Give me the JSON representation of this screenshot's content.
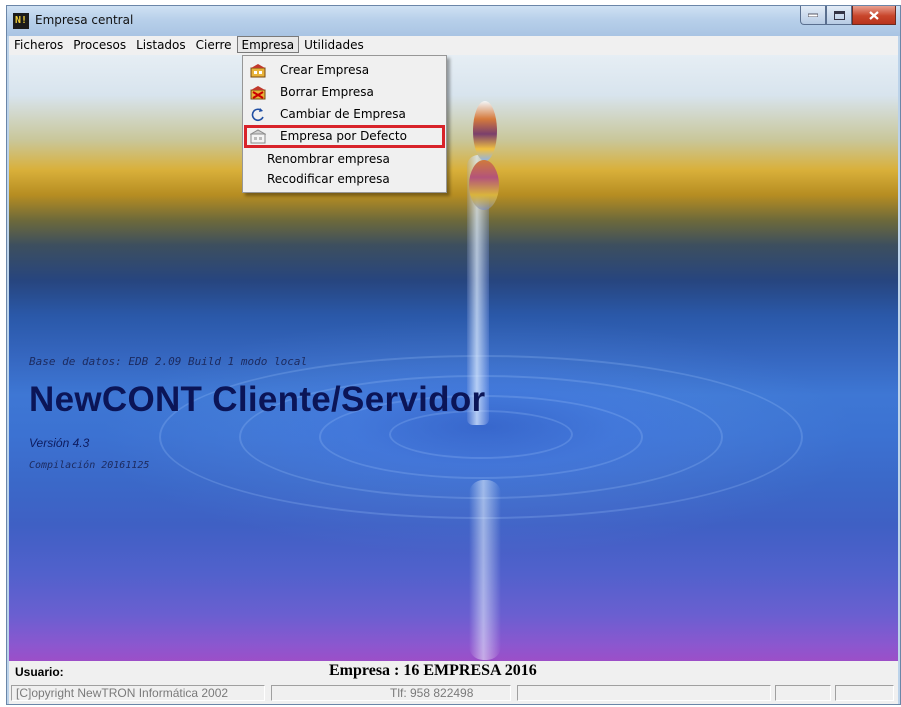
{
  "window": {
    "title": "Empresa central",
    "icon_text": "N!"
  },
  "menubar": {
    "items": [
      "Ficheros",
      "Procesos",
      "Listados",
      "Cierre",
      "Empresa",
      "Utilidades"
    ],
    "active": "Empresa"
  },
  "dropdown": {
    "items": [
      {
        "label": "Crear Empresa",
        "icon": "building-add-icon"
      },
      {
        "label": "Borrar Empresa",
        "icon": "building-delete-icon"
      },
      {
        "label": "Cambiar de Empresa",
        "icon": "refresh-icon"
      },
      {
        "label": "Empresa por Defecto",
        "icon": "building-default-icon",
        "highlighted": true
      },
      {
        "label": "Renombrar empresa",
        "icon": ""
      },
      {
        "label": "Recodificar empresa",
        "icon": ""
      }
    ]
  },
  "splash": {
    "database": "Base de datos: EDB 2.09 Build 1 modo local",
    "product": "NewCONT Cliente/Servidor",
    "version": "Versión 4.3",
    "build": "Compilación 20161125"
  },
  "status": {
    "user_label": "Usuario:",
    "company": "Empresa : 16 EMPRESA 2016",
    "copyright": "[C]opyright NewTRON Informática 2002",
    "phone": "Tlf: 958 822498"
  },
  "colors": {
    "highlight_box": "#d8232a",
    "title_dark_blue": "#0b1557"
  }
}
